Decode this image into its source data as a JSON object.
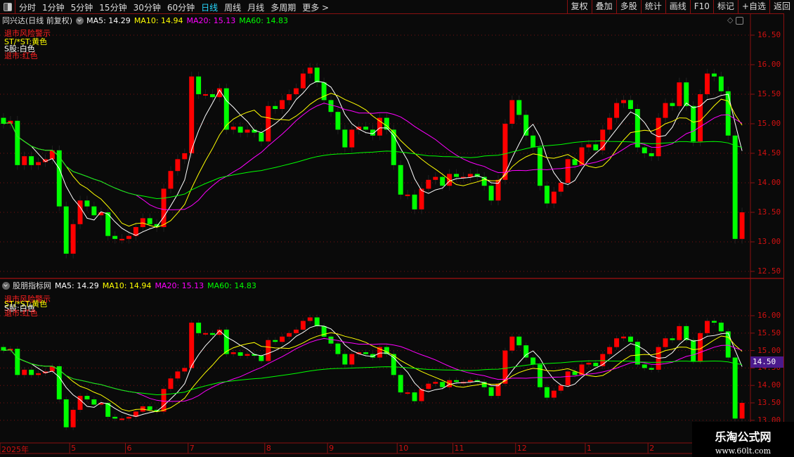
{
  "toolbar": {
    "periods": [
      "分时",
      "1分钟",
      "5分钟",
      "15分钟",
      "30分钟",
      "60分钟",
      "日线",
      "周线",
      "月线",
      "多周期",
      "更多 >"
    ],
    "active": "日线",
    "right_buttons": [
      "复权",
      "叠加",
      "多股",
      "统计",
      "画线",
      "F10",
      "标记",
      "+自选",
      "返回"
    ]
  },
  "main_panel": {
    "title": "同兴达(日线 前复权)",
    "ma5": "MA5: 14.29",
    "ma10": "MA10: 14.94",
    "ma20": "MA20: 15.13",
    "ma60": "MA60: 14.83",
    "y_ticks": [
      "16.50",
      "16.00",
      "15.50",
      "15.00",
      "14.50",
      "14.00",
      "13.50",
      "13.00",
      "12.50"
    ]
  },
  "indicator_panel": {
    "title": "股朋指标网",
    "ma5": "MA5: 14.29",
    "ma10": "MA10: 14.94",
    "ma20": "MA20: 15.13",
    "ma60": "MA60: 14.83",
    "y_ticks": [
      "16.00",
      "15.50",
      "15.00",
      "14.50",
      "14.00",
      "13.50",
      "13.00"
    ],
    "current_price": "14.50"
  },
  "warnings": {
    "delist_risk": "退市风险警示",
    "st": "ST/*ST:黄色",
    "s_share": "S股:白色",
    "delisted": "退市:红色"
  },
  "colors": {
    "up": "#ff0000",
    "down": "#00ff00",
    "ma5": "#ffffff",
    "ma10": "#ffff00",
    "ma20": "#ff00ff",
    "ma60": "#00ff00",
    "axis": "#d01010",
    "grid": "#7a1010"
  },
  "x_axis": [
    {
      "label": "2025年",
      "index": 0
    },
    {
      "label": "5",
      "index": 10
    },
    {
      "label": "6",
      "index": 18
    },
    {
      "label": "7",
      "index": 27
    },
    {
      "label": "8",
      "index": 38
    },
    {
      "label": "9",
      "index": 47
    },
    {
      "label": "10",
      "index": 57
    },
    {
      "label": "11",
      "index": 65
    },
    {
      "label": "12",
      "index": 74
    },
    {
      "label": "1",
      "index": 84
    },
    {
      "label": "2",
      "index": 93
    }
  ],
  "watermark": {
    "name": "乐淘公式网",
    "url": "www.60lt.com"
  },
  "chart_data": {
    "type": "candlestick",
    "ylim_main": [
      12.3,
      16.7
    ],
    "ylim_indicator": [
      12.9,
      16.2
    ],
    "close": [
      15.0,
      15.05,
      14.3,
      14.45,
      14.3,
      14.35,
      14.4,
      14.55,
      13.6,
      12.8,
      13.3,
      13.7,
      13.6,
      13.45,
      13.5,
      13.1,
      13.05,
      13.05,
      13.1,
      13.25,
      13.4,
      13.3,
      13.25,
      13.9,
      14.2,
      14.4,
      14.5,
      15.8,
      15.5,
      15.5,
      15.45,
      15.6,
      14.9,
      14.95,
      14.85,
      14.9,
      14.85,
      14.7,
      15.3,
      15.25,
      15.4,
      15.5,
      15.6,
      15.85,
      15.95,
      15.7,
      15.4,
      15.2,
      14.9,
      14.6,
      14.9,
      14.95,
      14.9,
      14.8,
      15.1,
      14.9,
      14.3,
      13.8,
      13.8,
      13.55,
      13.9,
      14.05,
      14.1,
      13.95,
      14.15,
      14.1,
      14.1,
      14.15,
      14.1,
      13.95,
      13.7,
      14.05,
      15.0,
      15.4,
      15.15,
      14.8,
      14.6,
      13.95,
      13.65,
      13.85,
      14.0,
      14.4,
      14.3,
      14.6,
      14.65,
      14.55,
      14.9,
      15.1,
      15.35,
      15.4,
      15.25,
      14.6,
      14.5,
      14.45,
      15.1,
      15.35,
      15.3,
      15.7,
      15.3,
      14.7,
      15.5,
      15.85,
      15.8,
      15.55,
      14.8,
      13.05,
      13.5
    ],
    "moving_averages": [
      5,
      10,
      20,
      60
    ]
  }
}
